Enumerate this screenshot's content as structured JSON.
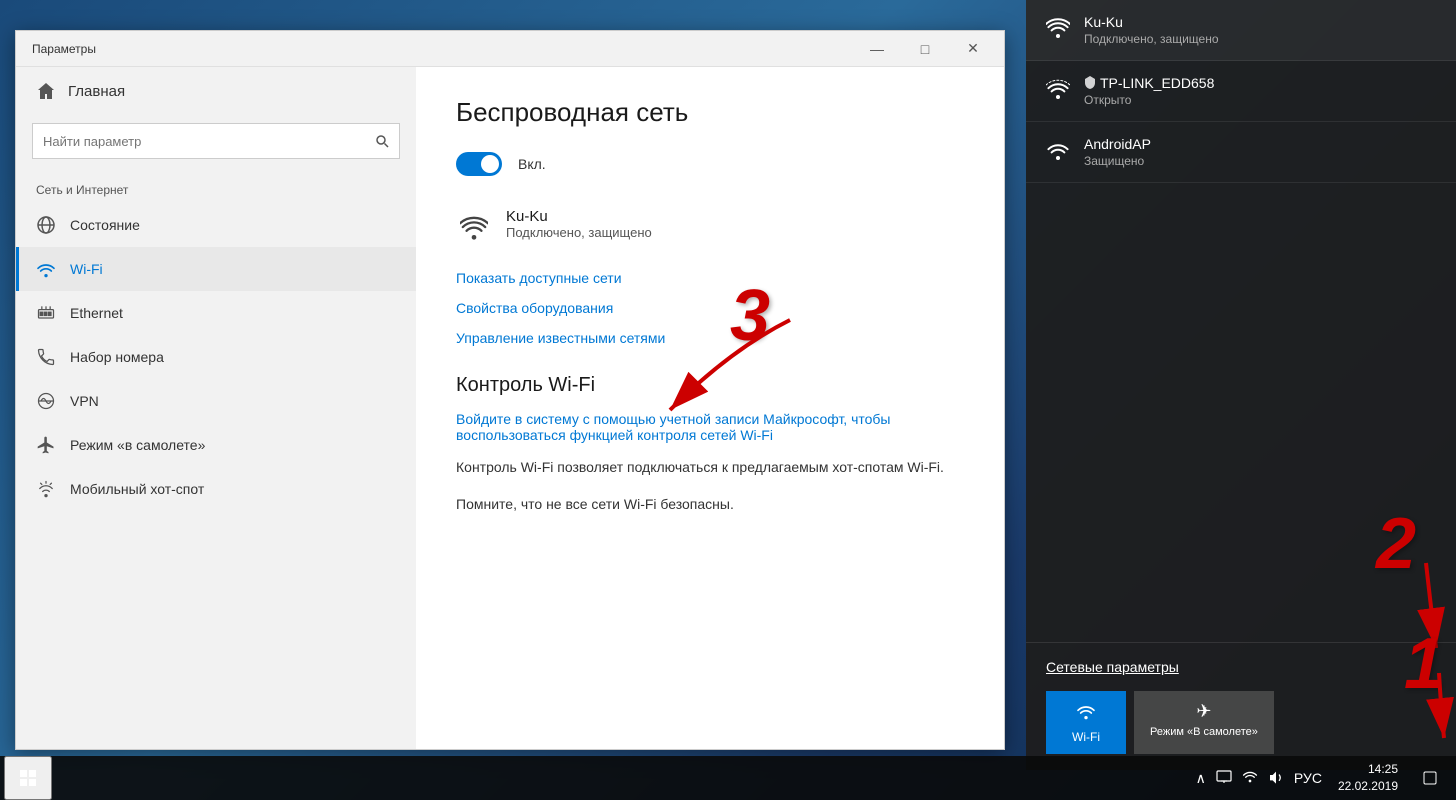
{
  "window": {
    "title": "Параметры",
    "minimize": "—",
    "maximize": "□",
    "close": "✕"
  },
  "sidebar": {
    "home_label": "Главная",
    "search_placeholder": "Найти параметр",
    "section_label": "Сеть и Интернет",
    "nav_items": [
      {
        "id": "status",
        "label": "Состояние",
        "icon": "globe"
      },
      {
        "id": "wifi",
        "label": "Wi-Fi",
        "icon": "wifi",
        "active": true
      },
      {
        "id": "ethernet",
        "label": "Ethernet",
        "icon": "monitor"
      },
      {
        "id": "dialup",
        "label": "Набор номера",
        "icon": "phone"
      },
      {
        "id": "vpn",
        "label": "VPN",
        "icon": "vpn"
      },
      {
        "id": "airplane",
        "label": "Режим «в самолете»",
        "icon": "airplane"
      },
      {
        "id": "hotspot",
        "label": "Мобильный хот-спот",
        "icon": "hotspot"
      }
    ]
  },
  "main": {
    "page_title": "Беспроводная сеть",
    "toggle_label": "Вкл.",
    "connected_network_name": "Ku-Ku",
    "connected_network_status": "Подключено, защищено",
    "link_show_networks": "Показать доступные сети",
    "link_adapter_props": "Свойства оборудования",
    "link_manage_networks": "Управление известными сетями",
    "wifi_control_title": "Контроль Wi-Fi",
    "control_link_text": "Войдите в систему с помощью учетной записи Майкрософт, чтобы воспользоваться функцией контроля сетей Wi-Fi",
    "desc1": "Контроль Wi-Fi позволяет подключаться к предлагаемым хот-спотам Wi-Fi.",
    "desc2": "Помните, что не все сети Wi-Fi безопасны."
  },
  "panel": {
    "networks": [
      {
        "id": "ku-ku",
        "name": "Ku-Ku",
        "status": "Подключено, защищено",
        "connected": true,
        "secured": true
      },
      {
        "id": "tp-link",
        "name": "TP-LINK_EDD658",
        "status": "Открыто",
        "connected": false,
        "secured": false
      },
      {
        "id": "androidap",
        "name": "AndroidAP",
        "status": "Защищено",
        "connected": false,
        "secured": true
      }
    ],
    "settings_label": "Сетевые параметры",
    "quick_actions": [
      {
        "id": "wifi",
        "label": "Wi-Fi",
        "active": true
      },
      {
        "id": "airplane",
        "label": "Режим «В самолете»",
        "active": false
      }
    ]
  },
  "taskbar": {
    "systray": {
      "chevron": "∧",
      "network_icon": "wifi",
      "volume_icon": "volume",
      "lang": "РУС"
    },
    "clock": {
      "time": "14:25",
      "date": "22.02.2019"
    }
  },
  "annotations": {
    "num1": "1",
    "num2": "2",
    "num3": "3"
  }
}
